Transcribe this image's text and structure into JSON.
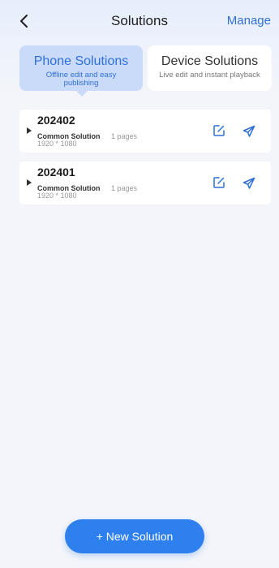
{
  "header": {
    "title": "Solutions",
    "manage_label": "Manage"
  },
  "tabs": [
    {
      "title": "Phone Solutions",
      "subtitle": "Offline edit and easy publishing",
      "active": true
    },
    {
      "title": "Device Solutions",
      "subtitle": "Live edit and instant playback",
      "active": false
    }
  ],
  "solutions": [
    {
      "name": "202402",
      "type": "Common Solution",
      "pages": "1 pages",
      "resolution": "1920 * 1080"
    },
    {
      "name": "202401",
      "type": "Common Solution",
      "pages": "1 pages",
      "resolution": "1920 * 1080"
    }
  ],
  "new_button_label": "+ New Solution",
  "colors": {
    "accent": "#2f6fd8",
    "button": "#2e80ee",
    "active_tab_bg": "#c9dbf8",
    "background": "#f3f5fa"
  },
  "icons": [
    "back-arrow-icon",
    "caret-right-icon",
    "edit-icon",
    "send-icon"
  ]
}
